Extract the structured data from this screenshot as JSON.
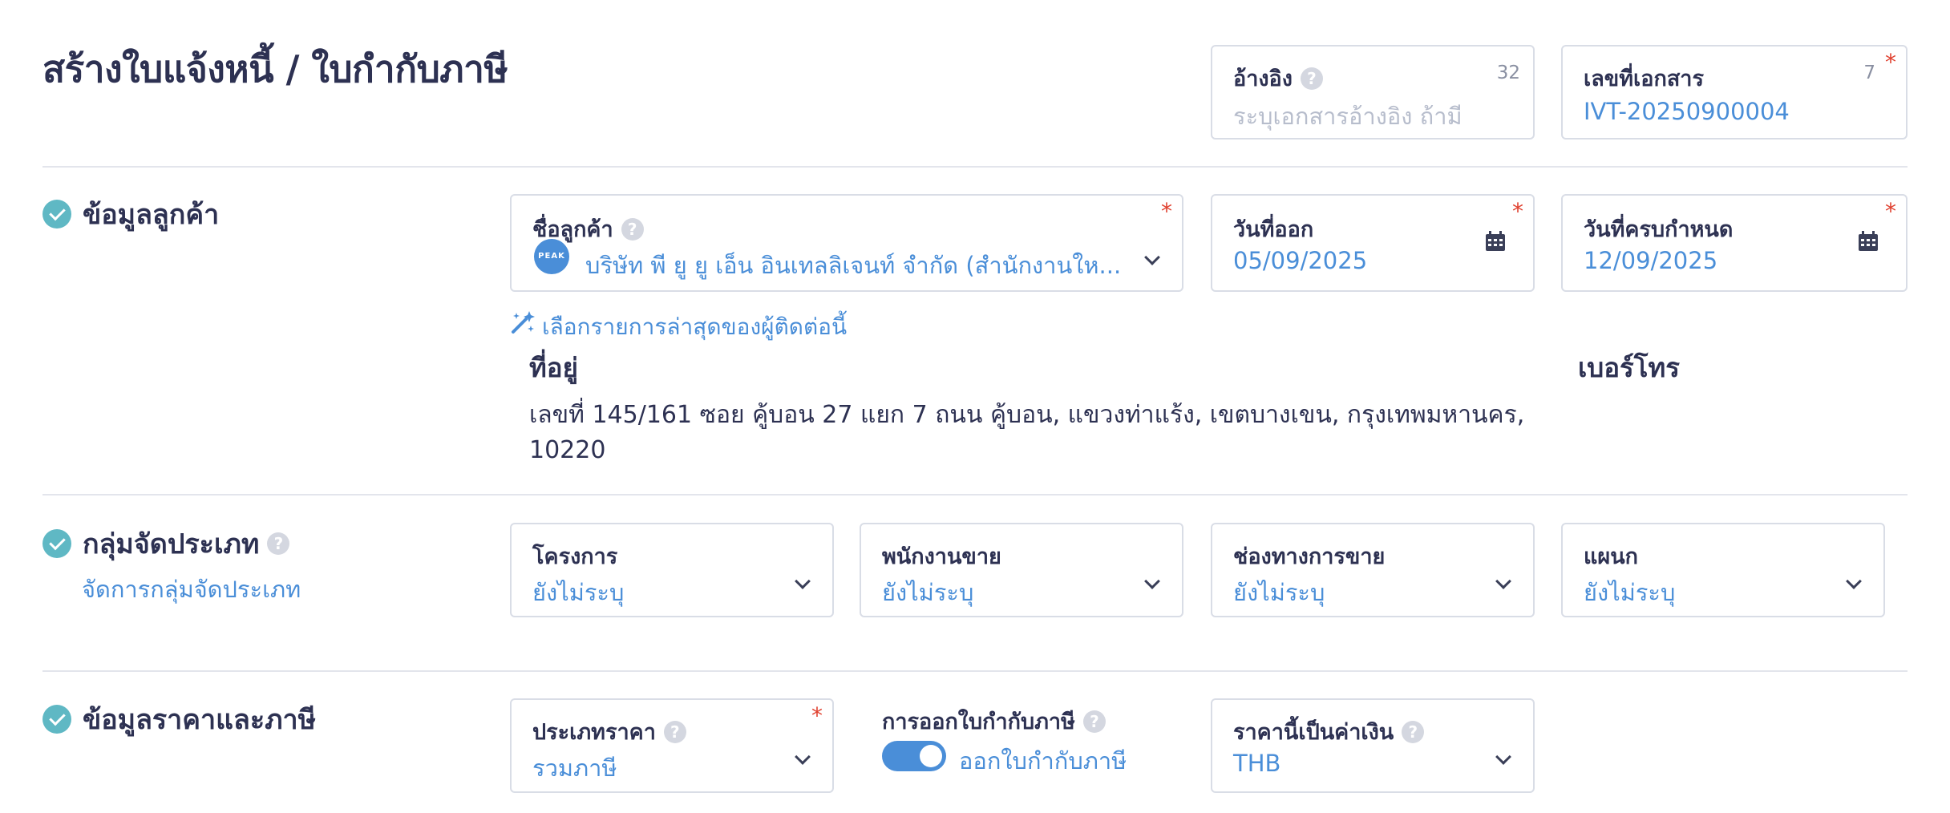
{
  "page": {
    "title": "สร้างใบแจ้งหนี้ / ใบกำกับภาษี"
  },
  "header": {
    "reference": {
      "label": "อ้างอิง",
      "placeholder": "ระบุเอกสารอ้างอิง ถ้ามี",
      "count": "32"
    },
    "doc_number": {
      "label": "เลขที่เอกสาร",
      "value": "IVT-20250900004",
      "count": "7"
    }
  },
  "customer": {
    "section_title": "ข้อมูลลูกค้า",
    "name": {
      "label": "ชื่อลูกค้า",
      "value": "บริษัท พี ยู ยู เอ็น อินเทลลิเจนท์ จำกัด (สำนักงานให...",
      "logo_text": "PEAK"
    },
    "issue_date": {
      "label": "วันที่ออก",
      "value": "05/09/2025"
    },
    "due_date": {
      "label": "วันที่ครบกำหนด",
      "value": "12/09/2025"
    },
    "recent_contact_link": "เลือกรายการล่าสุดของผู้ติดต่อนี้",
    "address_label": "ที่อยู่",
    "address_line1": "เลขที่ 145/161 ซอย คู้บอน 27 แยก 7 ถนน คู้บอน, แขวงท่าแร้ง, เขตบางเขน, กรุงเทพมหานคร,",
    "address_line2": "10220",
    "phone_label": "เบอร์โทร"
  },
  "classification": {
    "section_title": "กลุ่มจัดประเภท",
    "manage_link": "จัดการกลุ่มจัดประเภท",
    "project": {
      "label": "โครงการ",
      "value": "ยังไม่ระบุ"
    },
    "salesperson": {
      "label": "พนักงานขาย",
      "value": "ยังไม่ระบุ"
    },
    "channel": {
      "label": "ช่องทางการขาย",
      "value": "ยังไม่ระบุ"
    },
    "department": {
      "label": "แผนก",
      "value": "ยังไม่ระบุ"
    }
  },
  "pricing": {
    "section_title": "ข้อมูลราคาและภาษี",
    "price_type": {
      "label": "ประเภทราคา",
      "value": "รวมภาษี"
    },
    "tax_invoice": {
      "label": "การออกใบกำกับภาษี",
      "toggle_label": "ออกใบกำกับภาษี",
      "enabled": true
    },
    "currency": {
      "label": "ราคานี้เป็นค่าเงิน",
      "value": "THB"
    }
  },
  "colors": {
    "accent": "#4a8ed8",
    "required": "#e0402f",
    "check": "#5fb8c4",
    "text": "#2d3152"
  },
  "icons": [
    "help-icon",
    "calendar-icon",
    "chevron-down-icon",
    "check-circle-icon",
    "magic-wand-icon"
  ]
}
